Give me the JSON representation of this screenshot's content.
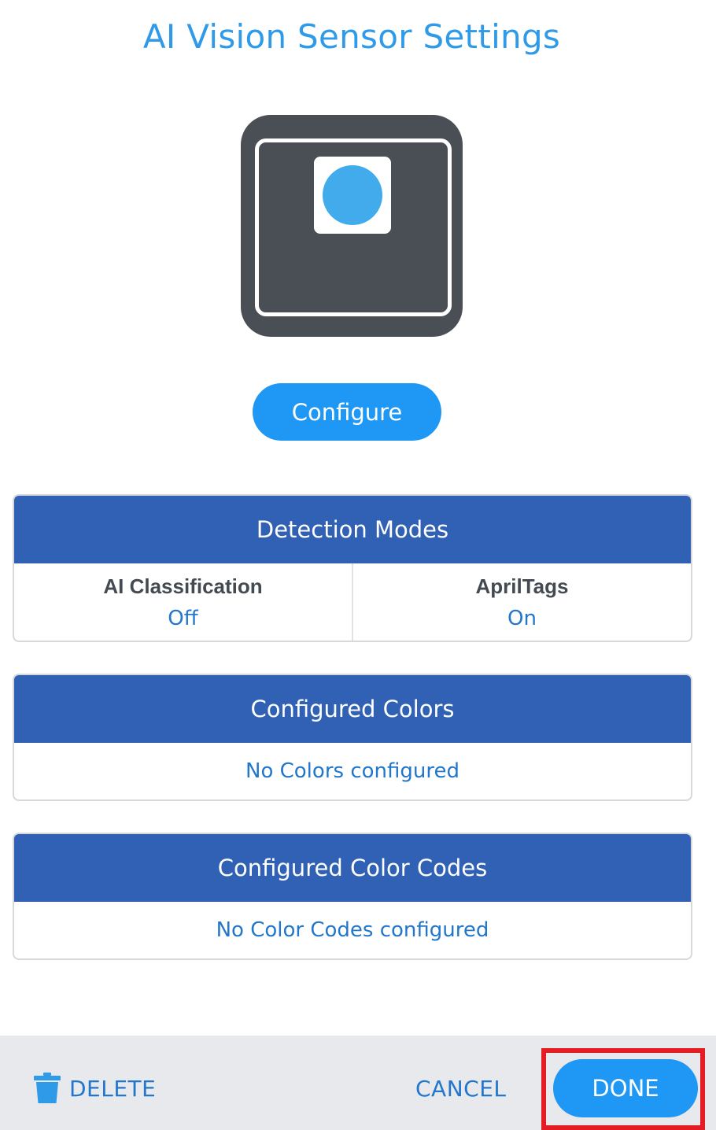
{
  "header": {
    "title": "AI Vision Sensor Settings"
  },
  "sensor": {
    "icon": "ai-vision-sensor-icon",
    "body_color": "#4a4e55",
    "lens_color": "#41abec"
  },
  "configure": {
    "label": "Configure"
  },
  "detection_modes": {
    "title": "Detection Modes",
    "modes": [
      {
        "name": "AI Classification",
        "value": "Off"
      },
      {
        "name": "AprilTags",
        "value": "On"
      }
    ]
  },
  "configured_colors": {
    "title": "Configured Colors",
    "empty_text": "No Colors configured"
  },
  "configured_color_codes": {
    "title": "Configured Color Codes",
    "empty_text": "No Color Codes configured"
  },
  "footer": {
    "delete_label": "DELETE",
    "delete_icon": "trash-icon",
    "cancel_label": "CANCEL",
    "done_label": "DONE"
  },
  "colors": {
    "accent": "#1f97f5",
    "panel_header": "#3161b4",
    "link_text": "#2277cc",
    "highlight": "#e41c24"
  }
}
